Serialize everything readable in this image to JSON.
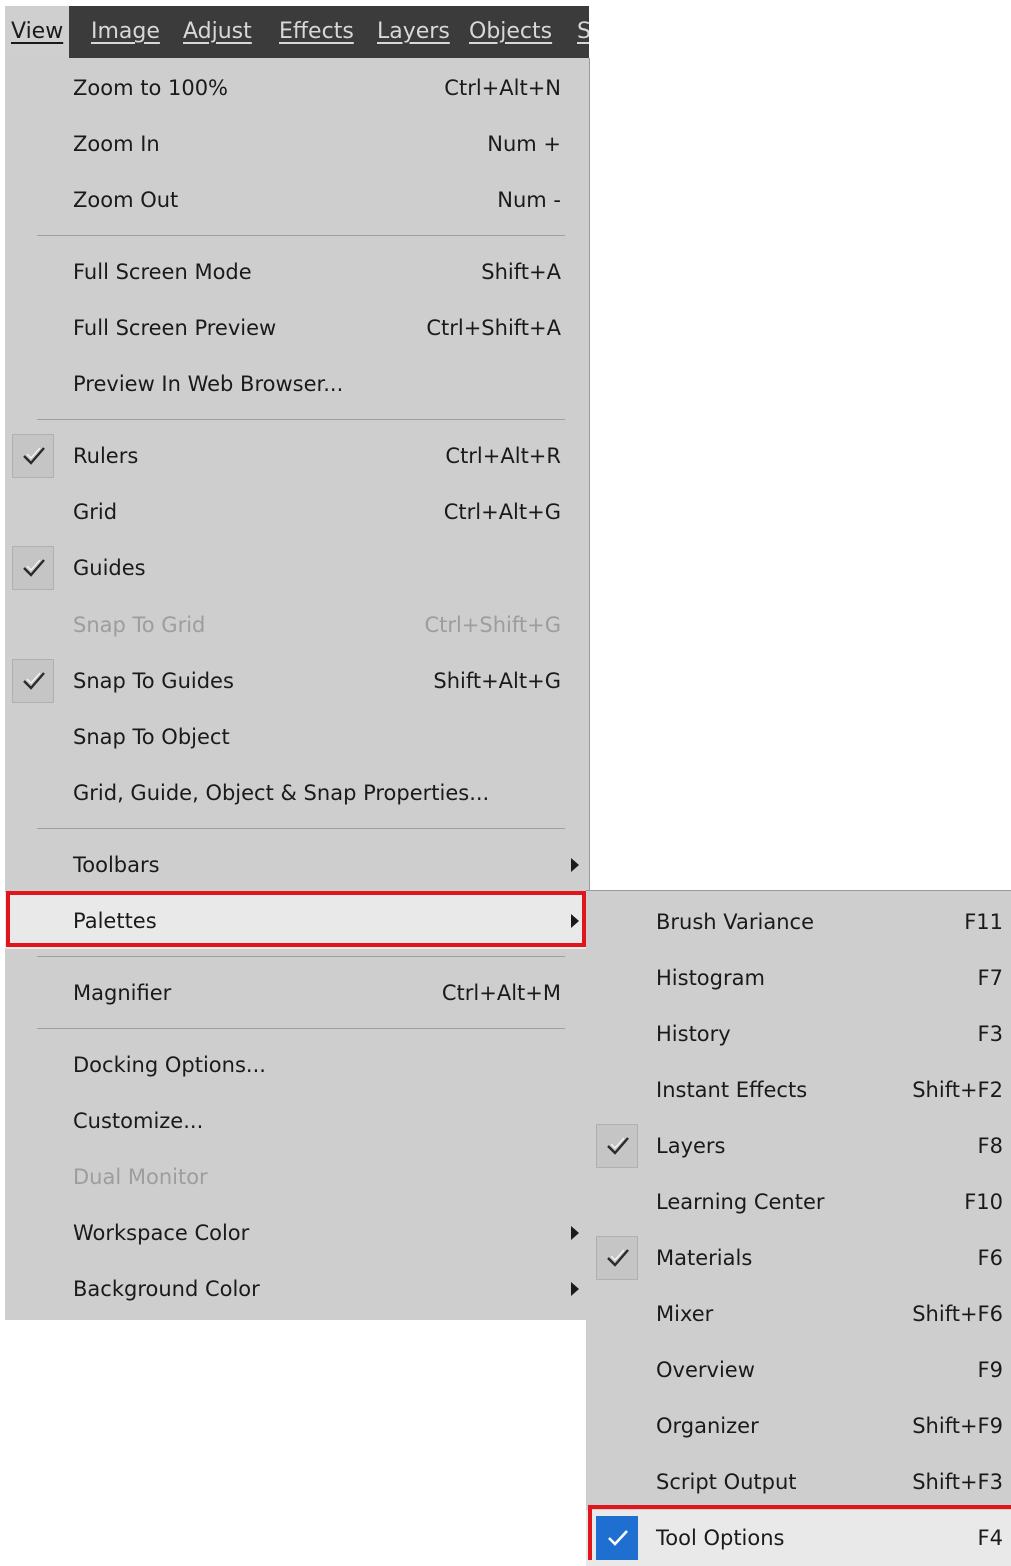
{
  "menubar": {
    "items": [
      "View",
      "Image",
      "Adjust",
      "Effects",
      "Layers",
      "Objects",
      "S"
    ]
  },
  "view_menu": {
    "items": [
      {
        "label": "Zoom to 100%",
        "shortcut": "Ctrl+Alt+N"
      },
      {
        "label": "Zoom In",
        "shortcut": "Num +"
      },
      {
        "label": "Zoom Out",
        "shortcut": "Num -"
      },
      {
        "label": "Full Screen Mode",
        "shortcut": "Shift+A"
      },
      {
        "label": "Full Screen Preview",
        "shortcut": "Ctrl+Shift+A"
      },
      {
        "label": "Preview In Web Browser...",
        "shortcut": ""
      },
      {
        "label": "Rulers",
        "shortcut": "Ctrl+Alt+R",
        "checked": true
      },
      {
        "label": "Grid",
        "shortcut": "Ctrl+Alt+G"
      },
      {
        "label": "Guides",
        "shortcut": "",
        "checked": true
      },
      {
        "label": "Snap To Grid",
        "shortcut": "Ctrl+Shift+G",
        "disabled": true
      },
      {
        "label": "Snap To Guides",
        "shortcut": "Shift+Alt+G",
        "checked": true
      },
      {
        "label": "Snap To Object",
        "shortcut": ""
      },
      {
        "label": "Grid, Guide, Object & Snap Properties...",
        "shortcut": ""
      },
      {
        "label": "Toolbars",
        "shortcut": "",
        "submenu": true
      },
      {
        "label": "Palettes",
        "shortcut": "",
        "submenu": true,
        "highlighted": true
      },
      {
        "label": "Magnifier",
        "shortcut": "Ctrl+Alt+M"
      },
      {
        "label": "Docking Options...",
        "shortcut": ""
      },
      {
        "label": "Customize...",
        "shortcut": ""
      },
      {
        "label": "Dual Monitor",
        "shortcut": "",
        "disabled": true
      },
      {
        "label": "Workspace Color",
        "shortcut": "",
        "submenu": true
      },
      {
        "label": "Background Color",
        "shortcut": "",
        "submenu": true
      }
    ]
  },
  "palettes_submenu": {
    "items": [
      {
        "label": "Brush Variance",
        "shortcut": "F11"
      },
      {
        "label": "Histogram",
        "shortcut": "F7"
      },
      {
        "label": "History",
        "shortcut": "F3"
      },
      {
        "label": "Instant Effects",
        "shortcut": "Shift+F2"
      },
      {
        "label": "Layers",
        "shortcut": "F8",
        "checked": true
      },
      {
        "label": "Learning Center",
        "shortcut": "F10"
      },
      {
        "label": "Materials",
        "shortcut": "F6",
        "checked": true
      },
      {
        "label": "Mixer",
        "shortcut": "Shift+F6"
      },
      {
        "label": "Overview",
        "shortcut": "F9"
      },
      {
        "label": "Organizer",
        "shortcut": "Shift+F9"
      },
      {
        "label": "Script Output",
        "shortcut": "Shift+F3"
      },
      {
        "label": "Tool Options",
        "shortcut": "F4",
        "checked": true,
        "highlighted": true
      }
    ]
  },
  "colors": {
    "menu_bg": "#cecece",
    "menubar_bg": "#3b3b3b",
    "highlight_border": "#e0161c",
    "check_blue": "#1f6fd1"
  }
}
